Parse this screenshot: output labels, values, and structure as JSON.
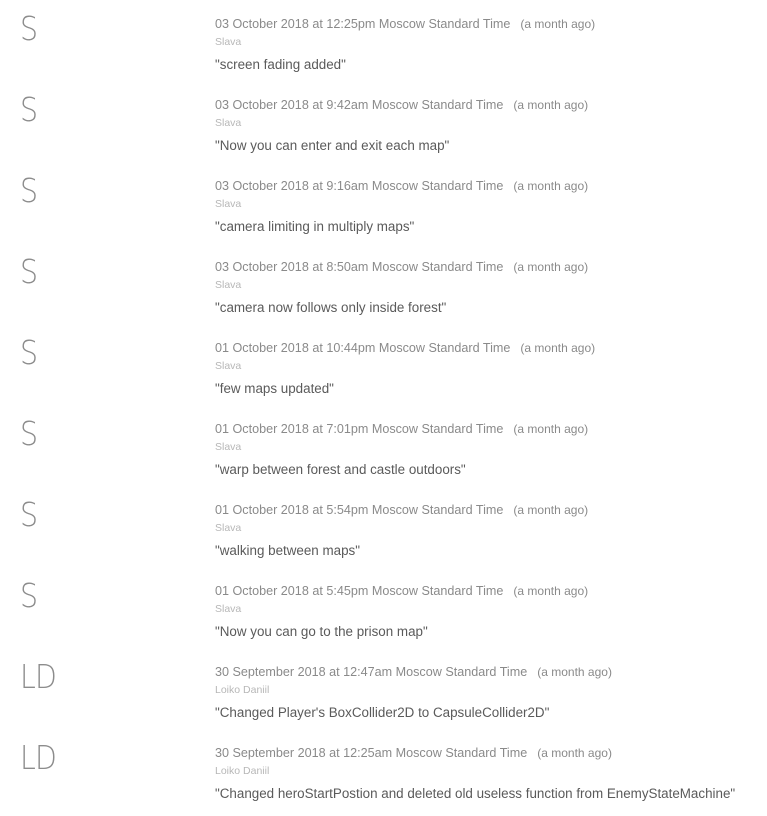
{
  "commits": [
    {
      "initials": "S",
      "date": "03 October 2018 at 12:25pm Moscow Standard Time",
      "ago": "(a month ago)",
      "author": "Slava",
      "message": "\"screen fading added\""
    },
    {
      "initials": "S",
      "date": "03 October 2018 at 9:42am Moscow Standard Time",
      "ago": "(a month ago)",
      "author": "Slava",
      "message": "\"Now you can enter and exit each map\""
    },
    {
      "initials": "S",
      "date": "03 October 2018 at 9:16am Moscow Standard Time",
      "ago": "(a month ago)",
      "author": "Slava",
      "message": "\"camera limiting in multiply maps\""
    },
    {
      "initials": "S",
      "date": "03 October 2018 at 8:50am Moscow Standard Time",
      "ago": "(a month ago)",
      "author": "Slava",
      "message": "\"camera now follows only inside forest\""
    },
    {
      "initials": "S",
      "date": "01 October 2018 at 10:44pm Moscow Standard Time",
      "ago": "(a month ago)",
      "author": "Slava",
      "message": "\"few maps updated\""
    },
    {
      "initials": "S",
      "date": "01 October 2018 at 7:01pm Moscow Standard Time",
      "ago": "(a month ago)",
      "author": "Slava",
      "message": "\"warp between forest and castle outdoors\""
    },
    {
      "initials": "S",
      "date": "01 October 2018 at 5:54pm Moscow Standard Time",
      "ago": "(a month ago)",
      "author": "Slava",
      "message": "\"walking between maps\""
    },
    {
      "initials": "S",
      "date": "01 October 2018 at 5:45pm Moscow Standard Time",
      "ago": "(a month ago)",
      "author": "Slava",
      "message": "\"Now you can go to the prison map\""
    },
    {
      "initials": "LD",
      "date": "30 September 2018 at 12:47am Moscow Standard Time",
      "ago": "(a month ago)",
      "author": "Loiko Daniil",
      "message": "\"Changed Player's BoxCollider2D to CapsuleCollider2D\""
    },
    {
      "initials": "LD",
      "date": "30 September 2018 at 12:25am Moscow Standard Time",
      "ago": "(a month ago)",
      "author": "Loiko Daniil",
      "message": "\"Changed heroStartPostion and deleted old useless function from EnemyStateMachine\""
    }
  ]
}
